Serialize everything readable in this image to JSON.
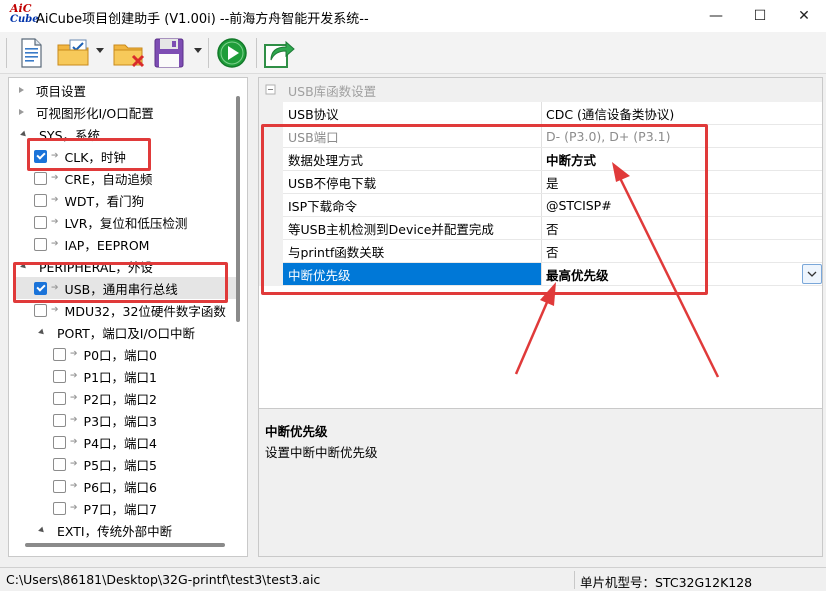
{
  "window": {
    "logo_top": "AiC",
    "logo_bottom": "Cube",
    "title": "AiCube项目创建助手 (V1.00i) --前海方舟智能开发系统--",
    "minimize_glyph": "—",
    "maximize_glyph": "☐",
    "close_glyph": "✕"
  },
  "toolbar": {
    "icons": [
      "new-document-icon",
      "open-folder-icon",
      "delete-folder-icon",
      "save-icon",
      "run-icon",
      "export-icon"
    ]
  },
  "tree": {
    "items": [
      {
        "label": "项目设置",
        "type": "leaf"
      },
      {
        "label": "可视图形化I/O口配置",
        "type": "leaf"
      },
      {
        "label": "SYS，系统",
        "type": "group"
      },
      {
        "label": "CLK，时钟",
        "type": "check",
        "checked": true
      },
      {
        "label": "CRE，自动追频",
        "type": "check",
        "checked": false
      },
      {
        "label": "WDT，看门狗",
        "type": "check",
        "checked": false
      },
      {
        "label": "LVR，复位和低压检测",
        "type": "check",
        "checked": false
      },
      {
        "label": "IAP，EEPROM",
        "type": "check",
        "checked": false
      },
      {
        "label": "PERIPHERAL，外设",
        "type": "group"
      },
      {
        "label": "USB，通用串行总线",
        "type": "check",
        "checked": true,
        "selected": true
      },
      {
        "label": "MDU32，32位硬件数字函数",
        "type": "check",
        "checked": false
      },
      {
        "label": "PORT，端口及I/O口中断",
        "type": "subgroup"
      },
      {
        "label": "P0口，端口0",
        "type": "subcheck",
        "checked": false
      },
      {
        "label": "P1口，端口1",
        "type": "subcheck",
        "checked": false
      },
      {
        "label": "P2口，端口2",
        "type": "subcheck",
        "checked": false
      },
      {
        "label": "P3口，端口3",
        "type": "subcheck",
        "checked": false
      },
      {
        "label": "P4口，端口4",
        "type": "subcheck",
        "checked": false
      },
      {
        "label": "P5口，端口5",
        "type": "subcheck",
        "checked": false
      },
      {
        "label": "P6口，端口6",
        "type": "subcheck",
        "checked": false
      },
      {
        "label": "P7口，端口7",
        "type": "subcheck",
        "checked": false
      },
      {
        "label": "EXTI，传统外部中断",
        "type": "subgroup"
      }
    ]
  },
  "props": {
    "section_title": "USB库函数设置",
    "rows": [
      {
        "key": "USB协议",
        "value": "CDC (通信设备类协议)",
        "disabled": false,
        "bold": false
      },
      {
        "key": "USB端口",
        "value": "D- (P3.0), D+ (P3.1)",
        "disabled": true,
        "bold": false
      },
      {
        "key": "数据处理方式",
        "value": "中断方式",
        "disabled": false,
        "bold": true
      },
      {
        "key": "USB不停电下载",
        "value": "是",
        "disabled": false,
        "bold": false
      },
      {
        "key": "ISP下载命令",
        "value": "@STCISP#",
        "disabled": false,
        "bold": false
      },
      {
        "key": "等USB主机检测到Device并配置完成",
        "value": "否",
        "disabled": false,
        "bold": false
      },
      {
        "key": "与printf函数关联",
        "value": "否",
        "disabled": false,
        "bold": false
      },
      {
        "key": "中断优先级",
        "value": "最高优先级",
        "disabled": false,
        "bold": true,
        "selected": true
      }
    ],
    "description_title": "中断优先级",
    "description_text": "设置中断中断优先级"
  },
  "statusbar": {
    "path": "C:\\Users\\86181\\Desktop\\32G-printf\\test3\\test3.aic",
    "mcu_model": "单片机型号：STC32G12K128"
  },
  "colors": {
    "selection_blue": "#0078d7",
    "annotation_red": "#e03a3a",
    "check_blue": "#1a73d9"
  }
}
